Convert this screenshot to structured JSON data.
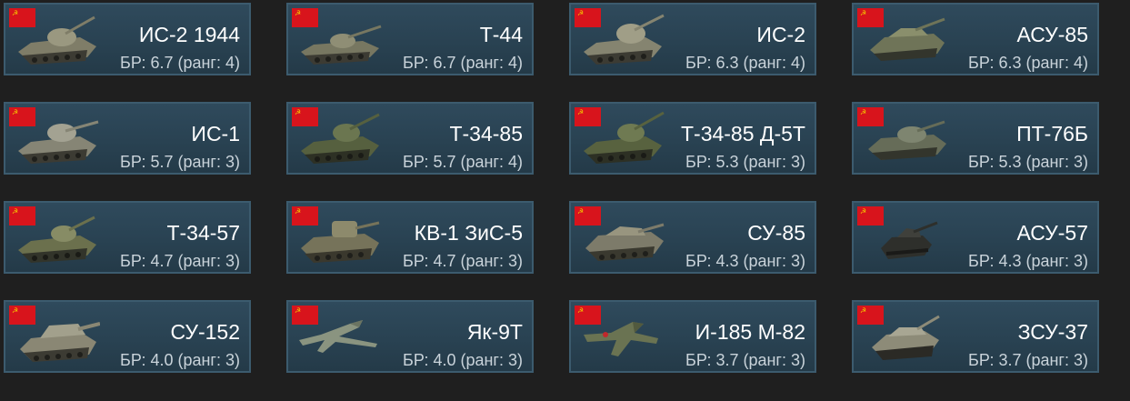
{
  "colors": {
    "background": "#1f1f1f",
    "card": "#2c4656",
    "card_border": "#3c5b6e",
    "flag": "#d8141c",
    "flag_symbol": "#f3c400",
    "name_text": "#ffffff",
    "rating_text": "#c9d3da"
  },
  "vehicles": [
    {
      "name": "ИС-2 1944",
      "rating": "БР: 6.7 (ранг: 4)",
      "kind": "tank",
      "flag": "soviet-flag-icon"
    },
    {
      "name": "Т-44",
      "rating": "БР: 6.7 (ранг: 4)",
      "kind": "tank",
      "flag": "soviet-flag-icon"
    },
    {
      "name": "ИС-2",
      "rating": "БР: 6.3 (ранг: 4)",
      "kind": "tank",
      "flag": "soviet-flag-icon"
    },
    {
      "name": "АСУ-85",
      "rating": "БР: 6.3 (ранг: 4)",
      "kind": "spg",
      "flag": "soviet-flag-icon"
    },
    {
      "name": "ИС-1",
      "rating": "БР: 5.7 (ранг: 3)",
      "kind": "tank",
      "flag": "soviet-flag-icon"
    },
    {
      "name": "Т-34-85",
      "rating": "БР: 5.7 (ранг: 4)",
      "kind": "tank",
      "flag": "soviet-flag-icon"
    },
    {
      "name": "Т-34-85 Д-5Т",
      "rating": "БР: 5.3 (ранг: 3)",
      "kind": "tank",
      "flag": "soviet-flag-icon"
    },
    {
      "name": "ПТ-76Б",
      "rating": "БР: 5.3 (ранг: 3)",
      "kind": "light-tank",
      "flag": "soviet-flag-icon"
    },
    {
      "name": "Т-34-57",
      "rating": "БР: 4.7 (ранг: 3)",
      "kind": "tank",
      "flag": "soviet-flag-icon"
    },
    {
      "name": "КВ-1 ЗиС-5",
      "rating": "БР: 4.7 (ранг: 3)",
      "kind": "tank",
      "flag": "soviet-flag-icon"
    },
    {
      "name": "СУ-85",
      "rating": "БР: 4.3 (ранг: 3)",
      "kind": "spg",
      "flag": "soviet-flag-icon"
    },
    {
      "name": "АСУ-57",
      "rating": "БР: 4.3 (ранг: 3)",
      "kind": "small-spg",
      "flag": "soviet-flag-icon"
    },
    {
      "name": "СУ-152",
      "rating": "БР: 4.0 (ранг: 3)",
      "kind": "spg",
      "flag": "soviet-flag-icon"
    },
    {
      "name": "Як-9Т",
      "rating": "БР: 4.0 (ранг: 3)",
      "kind": "plane",
      "flag": "soviet-flag-icon"
    },
    {
      "name": "И-185 М-82",
      "rating": "БР: 3.7 (ранг: 3)",
      "kind": "plane",
      "flag": "soviet-flag-icon"
    },
    {
      "name": "ЗСУ-37",
      "rating": "БР: 3.7 (ранг: 3)",
      "kind": "spaa",
      "flag": "soviet-flag-icon"
    }
  ]
}
